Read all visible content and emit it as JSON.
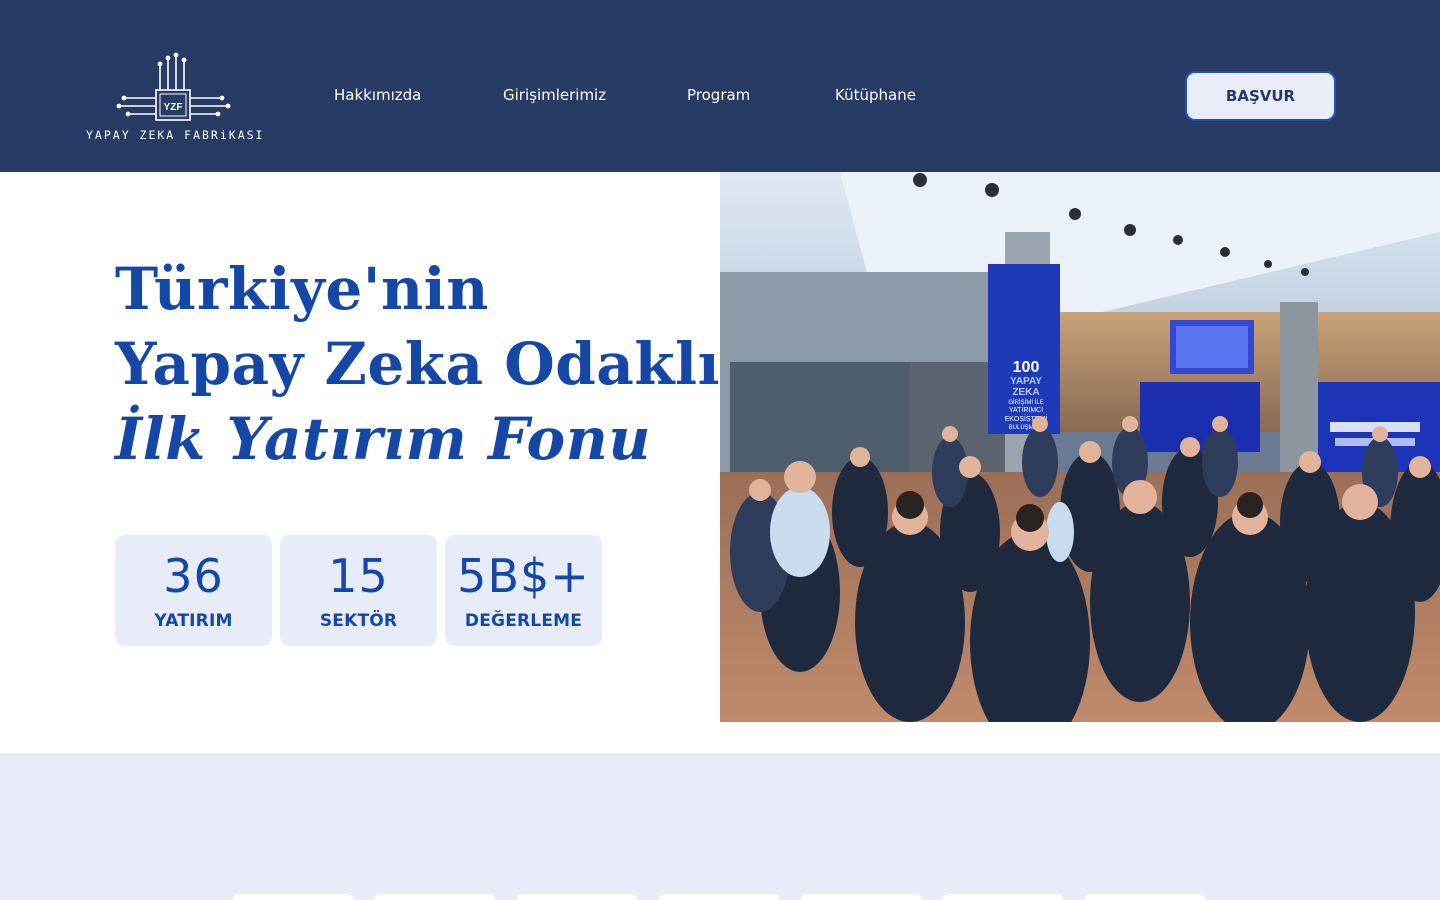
{
  "header": {
    "logo_text": "YAPAY ZEKA FABRiKASI",
    "logo_chip_text": "YZF",
    "nav": [
      "Hakkımızda",
      "Girişimlerimiz",
      "Program",
      "Kütüphane"
    ],
    "cta_label": "BAŞVUR"
  },
  "hero": {
    "title_line1": "Türkiye'nin",
    "title_line2": "Yapay Zeka Odaklı",
    "title_line3": "İlk Yatırım Fonu",
    "stats": [
      {
        "value": "36",
        "label": "YATIRIM"
      },
      {
        "value": "15",
        "label": "SEKTÖR"
      },
      {
        "value": "5B$+",
        "label": "DEĞERLEME"
      }
    ]
  },
  "photo": {
    "banner_number": "100",
    "banner_line1": "YAPAY",
    "banner_line2": "ZEKA",
    "banner_line3": "GİRİŞİMİ İLE",
    "banner_line4": "YATIRIMCI",
    "banner_line5": "EKOSİSTEMİ",
    "banner_line6": "BULUŞMASI"
  },
  "colors": {
    "header_bg": "#273b64",
    "accent_blue": "#1547a6",
    "stat_bg": "#e7ecf8",
    "cta_border": "#1f54b8"
  }
}
